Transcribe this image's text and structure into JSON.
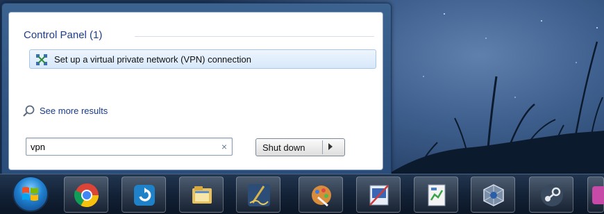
{
  "start_menu": {
    "section_header": "Control Panel (1)",
    "result_item": "Set up a virtual private network (VPN) connection",
    "see_more": "See more results",
    "search": {
      "value": "vpn",
      "clear_icon": "×"
    },
    "shutdown_label": "Shut down"
  },
  "taskbar": {
    "start_orb_icon": "windows-logo-icon",
    "items": [
      {
        "icon": "chrome-icon"
      },
      {
        "icon": "sync-app-icon"
      },
      {
        "icon": "file-explorer-icon"
      },
      {
        "icon": "pen-app-icon"
      },
      {
        "icon": "paint-app-icon"
      },
      {
        "icon": "image-editor-icon"
      },
      {
        "icon": "document-chart-icon"
      },
      {
        "icon": "virtualbox-icon"
      },
      {
        "icon": "steam-icon"
      },
      {
        "icon": "app-icon-partial"
      }
    ]
  }
}
